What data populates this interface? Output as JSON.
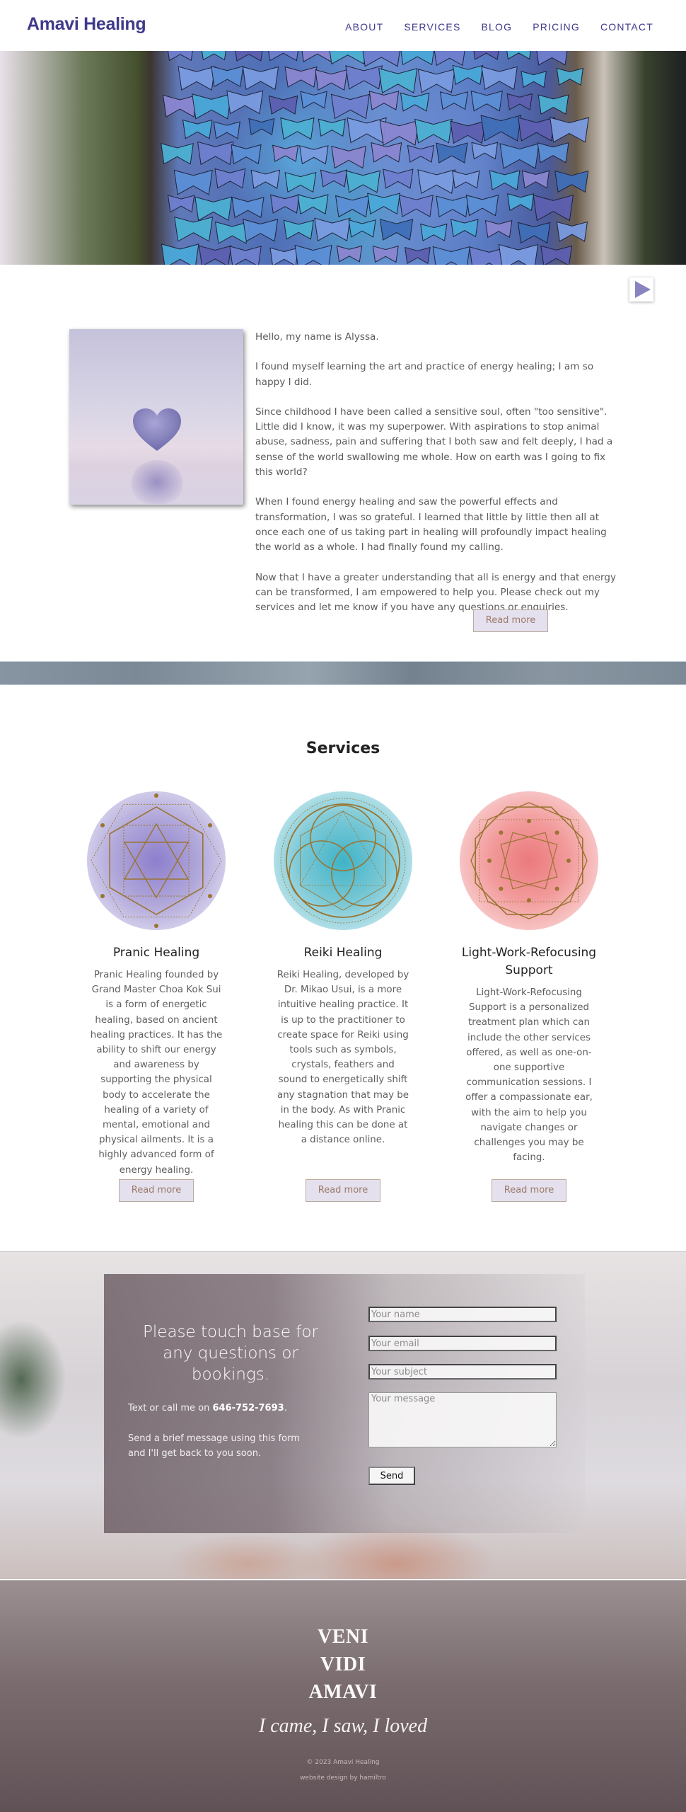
{
  "header": {
    "logo": "Amavi Healing",
    "nav": [
      "ABOUT",
      "SERVICES",
      "BLOG",
      "PRICING",
      "CONTACT"
    ]
  },
  "hero": {
    "image_subject": "blue morpho butterflies covering a tree trunk",
    "play_icon": "play-triangle"
  },
  "about": {
    "image_subject": "purple heart floating over water",
    "paragraphs": [
      "Hello, my name is Alyssa.",
      "I found myself learning the art and practice of energy healing; I am so happy I did.",
      "Since childhood I have been called a sensitive soul, often \"too sensitive\". Little did I know, it was my superpower. With aspirations to stop animal abuse, sadness, pain and suffering that I both saw and felt deeply, I had a sense of the world swallowing me whole. How on earth was I going to fix this world?",
      "When I found energy healing and saw the powerful effects and transformation, I was so grateful. I learned that little by little then all at once each one of us taking part in healing will profoundly impact healing the world as a whole. I had finally found my calling.",
      "Now that I have a greater understanding that all is energy and that energy can be transformed, I am empowered to help you. Please check out my services and let me know if you have any questions or enquiries."
    ],
    "read_more": "Read more"
  },
  "services": {
    "title": "Services",
    "items": [
      {
        "title": "Pranic Healing",
        "description": "Pranic Healing founded by Grand Master Choa Kok Sui is a form of energetic healing, based on ancient healing practices. It has the ability to shift our energy and awareness by supporting the physical body to accelerate the healing of a variety of mental, emotional and physical ailments. It is a highly advanced form of energy healing.",
        "read_more": "Read more",
        "emblem_color": "#8d7fcc"
      },
      {
        "title": "Reiki Healing",
        "description": "Reiki Healing, developed by Dr. Mikao Usui, is a more intuitive healing practice. It is up to the practitioner to create space for Reiki using tools such as symbols, crystals, feathers and sound to energetically shift any stagnation that may be in the body. As with Pranic healing this can be done at a distance online.",
        "read_more": "Read more",
        "emblem_color": "#3fb3c7"
      },
      {
        "title": "Light-Work-Refocusing Support",
        "description": "Light-Work-Refocusing Support is a personalized treatment plan which can include the other services offered, as well as one-on-one supportive communication sessions. I offer a compassionate ear, with the aim to help you navigate changes or challenges you may be facing.",
        "read_more": "Read more",
        "emblem_color": "#eb7a7d"
      }
    ]
  },
  "contact": {
    "heading": "Please touch base for any questions or bookings.",
    "phone_prefix": "Text or call me on ",
    "phone": "646-752-7693",
    "phone_suffix": ".",
    "message": "Send a brief message using this form and I'll get back to you soon.",
    "form": {
      "name_placeholder": "Your name",
      "email_placeholder": "Your email",
      "subject_placeholder": "Your subject",
      "message_placeholder": "Your message",
      "send_label": "Send"
    }
  },
  "footer": {
    "motto": [
      "VENI",
      "VIDI",
      "AMAVI"
    ],
    "tagline": "I came, I saw, I loved",
    "copyright": "© 2023 Amavi Healing",
    "credit": "website design by hamiltro"
  },
  "colors": {
    "brand": "#3f3a8c",
    "button_bg": "#e4e0ee",
    "button_text": "#9c7a67",
    "footer_top": "#9b8f91",
    "footer_bottom": "#5f5155"
  }
}
